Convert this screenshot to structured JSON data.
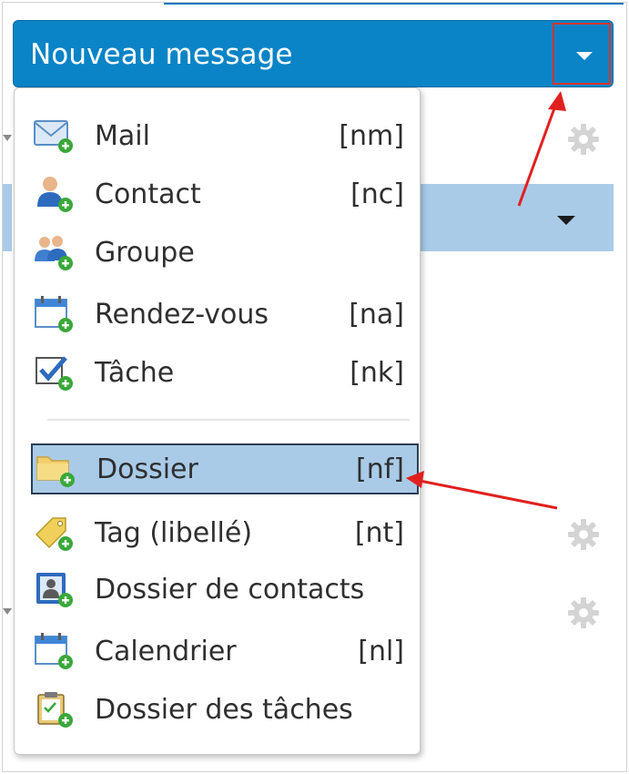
{
  "header": {
    "new_label": "Nouveau message"
  },
  "menu": {
    "items": [
      {
        "label": "Mail",
        "shortcut": "[nm]",
        "icon": "mail-add-icon"
      },
      {
        "label": "Contact",
        "shortcut": "[nc]",
        "icon": "contact-add-icon"
      },
      {
        "label": "Groupe",
        "shortcut": "",
        "icon": "group-add-icon"
      },
      {
        "label": "Rendez-vous",
        "shortcut": "[na]",
        "icon": "appointment-add-icon"
      },
      {
        "label": "Tâche",
        "shortcut": "[nk]",
        "icon": "task-add-icon"
      },
      {
        "label": "Dossier",
        "shortcut": "[nf]",
        "icon": "folder-add-icon",
        "selected": true
      },
      {
        "label": "Tag (libellé)",
        "shortcut": "[nt]",
        "icon": "tag-add-icon"
      },
      {
        "label": "Dossier de contacts",
        "shortcut": "",
        "icon": "contact-folder-add-icon"
      },
      {
        "label": "Calendrier",
        "shortcut": "[nl]",
        "icon": "calendar-add-icon"
      },
      {
        "label": "Dossier des tâches",
        "shortcut": "",
        "icon": "task-folder-add-icon"
      }
    ]
  },
  "colors": {
    "header_blue": "#0a84c6",
    "highlight": "#a9cbe8",
    "annotation_red": "#e02020"
  }
}
